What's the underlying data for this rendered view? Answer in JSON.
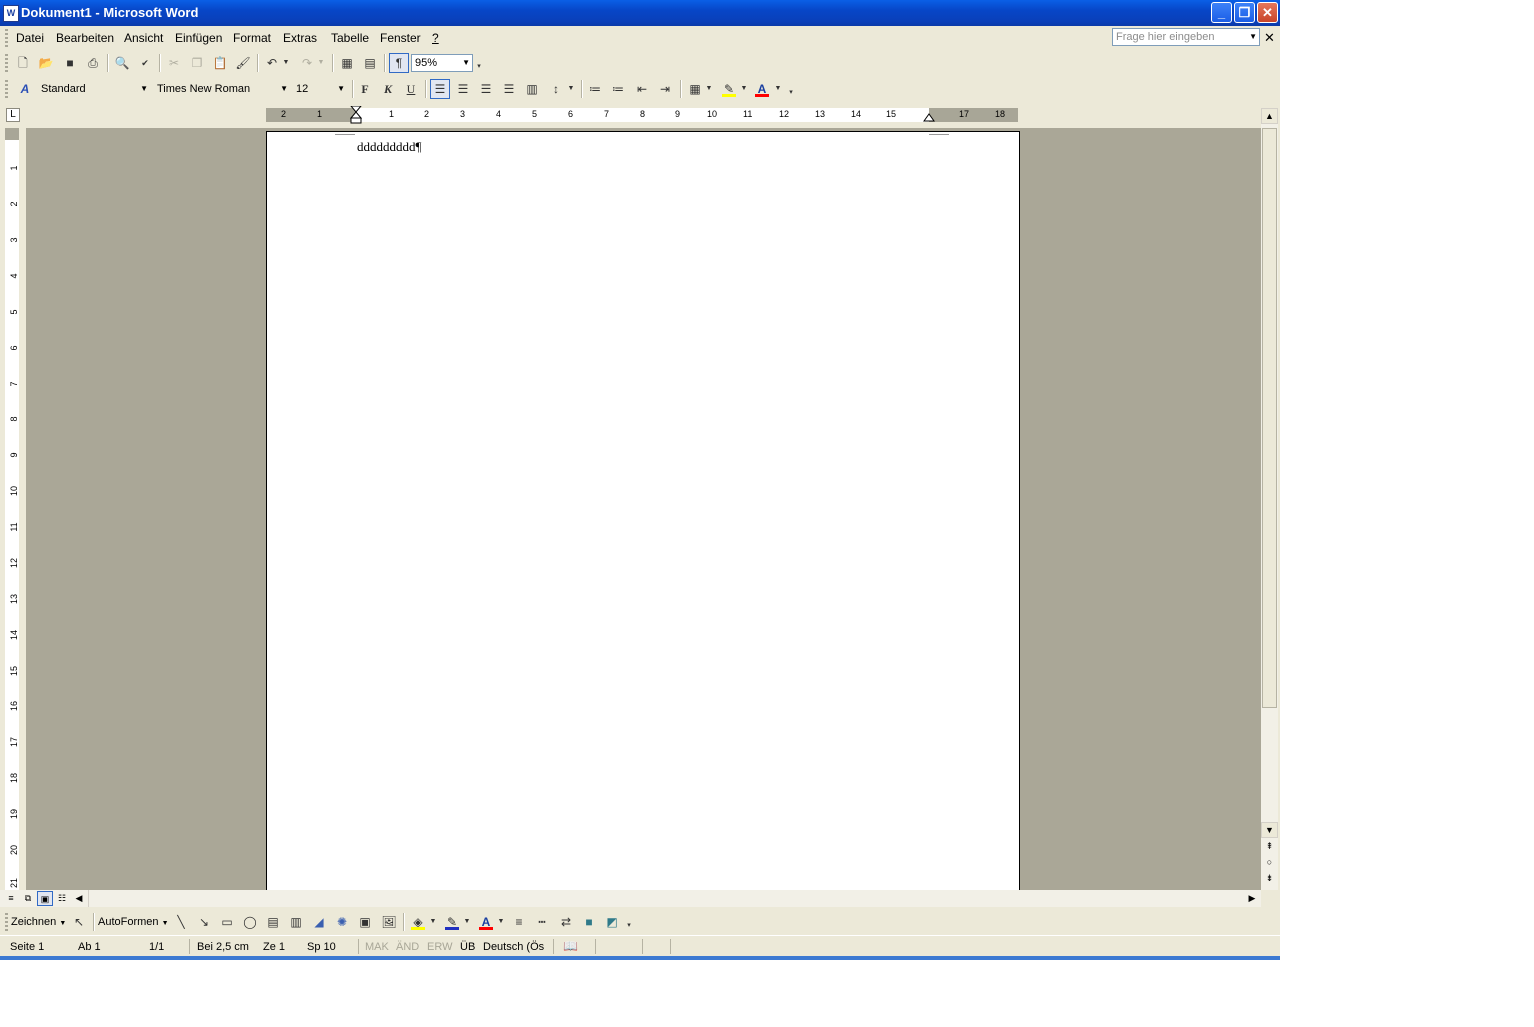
{
  "window": {
    "app_icon": "W",
    "title": "Dokument1 - Microsoft Word",
    "buttons": {
      "minimize": "_",
      "restore": "❐",
      "close": "✕"
    }
  },
  "menu": {
    "items": [
      "Datei",
      "Bearbeiten",
      "Ansicht",
      "Einfügen",
      "Format",
      "Extras",
      "Tabelle",
      "Fenster",
      "?"
    ],
    "help_placeholder": "Frage hier eingeben",
    "close_doc": "✕"
  },
  "standard_toolbar": {
    "zoom": "95%"
  },
  "format_toolbar": {
    "style": "Standard",
    "font": "Times New Roman",
    "size": "12",
    "bold": "F",
    "italic": "K",
    "underline": "U"
  },
  "ruler": {
    "corner": "L",
    "h_labels": [
      "2",
      "1",
      "",
      "1",
      "2",
      "3",
      "4",
      "5",
      "6",
      "7",
      "8",
      "9",
      "10",
      "11",
      "12",
      "13",
      "14",
      "15",
      "",
      "17",
      "18"
    ],
    "v_labels": [
      "1",
      "2",
      "3",
      "4",
      "5",
      "6",
      "7",
      "8",
      "9",
      "10",
      "11",
      "12",
      "13",
      "14",
      "15",
      "16",
      "17",
      "18",
      "19",
      "20",
      "21"
    ]
  },
  "document": {
    "text": "ddddddddd",
    "pilcrow": "¶"
  },
  "drawing_toolbar": {
    "zeichnen": "Zeichnen",
    "autoformen": "AutoFormen"
  },
  "status": {
    "seite": "Seite 1",
    "ab": "Ab 1",
    "pages": "1/1",
    "bei": "Bei 2,5 cm",
    "ze": "Ze 1",
    "sp": "Sp 10",
    "mak": "MAK",
    "aend": "ÄND",
    "erw": "ERW",
    "ueb": "ÜB",
    "language": "Deutsch (Ös"
  },
  "colors": {
    "titlebar": "#0a5fe6",
    "chrome": "#ece9d8",
    "workspace": "#aaa797",
    "highlight": "#ffff00",
    "font_color": "#ff0000"
  }
}
